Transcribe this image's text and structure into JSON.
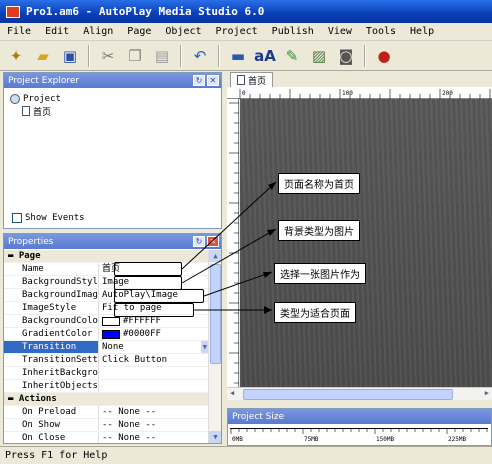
{
  "window": {
    "title": "Pro1.am6 - AutoPlay Media Studio 6.0"
  },
  "menu": [
    "File",
    "Edit",
    "Align",
    "Page",
    "Object",
    "Project",
    "Publish",
    "View",
    "Tools",
    "Help"
  ],
  "toolbar": {
    "icons": [
      "wand-icon",
      "open-folder-icon",
      "save-icon",
      "cut-icon",
      "copy-icon",
      "paste-icon",
      "undo-icon",
      "button-object-icon",
      "label-object-icon",
      "paragraph-object-icon",
      "image-object-icon",
      "video-object-icon",
      "flash-object-icon"
    ]
  },
  "explorer": {
    "title": "Project Explorer",
    "root": "Project",
    "page": "首页",
    "show_events": "Show Events"
  },
  "properties": {
    "title": "Properties",
    "page_category": "Page",
    "actions_category": "Actions",
    "rows": [
      {
        "name": "Name",
        "value": "首页"
      },
      {
        "name": "BackgroundStyle",
        "value": "Image"
      },
      {
        "name": "BackgroundImage",
        "value": "AutoPlay\\Image"
      },
      {
        "name": "ImageStyle",
        "value": "Fit to page"
      },
      {
        "name": "BackgroundColor",
        "value": "#FFFFFF",
        "swatch": "#FFFFFF"
      },
      {
        "name": "GradientColor",
        "value": "#0000FF",
        "swatch": "#0000FF"
      },
      {
        "name": "Transition",
        "value": "None",
        "selected": true
      },
      {
        "name": "TransitionSetti",
        "value": "Click Button"
      },
      {
        "name": "InheritBackgrou",
        "value": ""
      },
      {
        "name": "InheritObjects",
        "value": ""
      }
    ],
    "actions": [
      {
        "name": "On Preload",
        "value": "-- None --"
      },
      {
        "name": "On Show",
        "value": "-- None --"
      },
      {
        "name": "On Close",
        "value": "-- None --"
      }
    ]
  },
  "editor": {
    "tab": "首页",
    "ruler_labels": [
      "0",
      "100",
      "200"
    ]
  },
  "project_size": {
    "title": "Project Size",
    "ticks": [
      "0MB",
      "75MB",
      "150MB",
      "225MB",
      "300MB"
    ]
  },
  "annotations": [
    "页面名称为首页",
    "背景类型为图片",
    "选择一张图片作为",
    "类型为适合页面"
  ],
  "status": "Press F1 for Help",
  "colors": {
    "titlebar": "#0a3fb8",
    "panel_header": "#6a88d8",
    "selected_row": "#316ac5"
  }
}
